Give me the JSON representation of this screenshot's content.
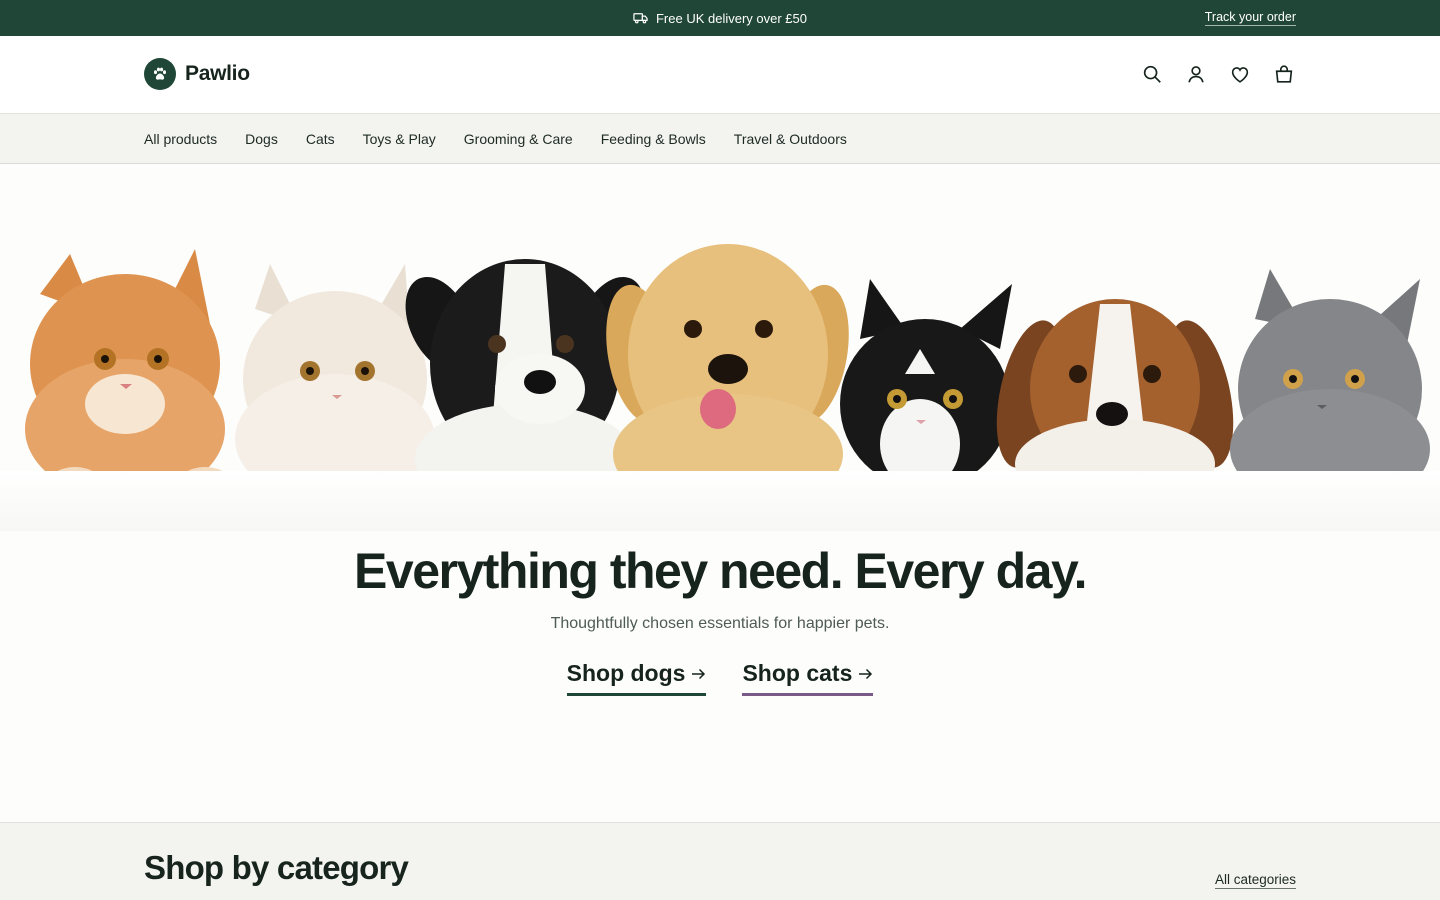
{
  "promo": {
    "icon": "truck-icon",
    "message": "Free UK delivery over £50",
    "track_link": "Track your order"
  },
  "header": {
    "logo_text": "Pawlio",
    "logo_icon": "paw-icon",
    "icons": [
      "search-icon",
      "account-icon",
      "wishlist-heart-icon",
      "bag-icon"
    ]
  },
  "nav": {
    "items": [
      "All products",
      "Dogs",
      "Cats",
      "Toys & Play",
      "Grooming & Care",
      "Feeding & Bowls",
      "Travel & Outdoors"
    ]
  },
  "hero": {
    "image_subject": "kittens and puppies peeking over a white ledge",
    "title": "Everything they need. Every day.",
    "subtitle": "Thoughtfully chosen essentials for happier pets.",
    "cta_dogs": "Shop dogs",
    "cta_cats": "Shop cats"
  },
  "categories": {
    "title": "Shop by category",
    "link": "All categories"
  },
  "colors": {
    "brand_green": "#1f4636",
    "accent_purple": "#7a5a86",
    "nav_bg": "#f3f3ef",
    "text_dark": "#16241d"
  }
}
